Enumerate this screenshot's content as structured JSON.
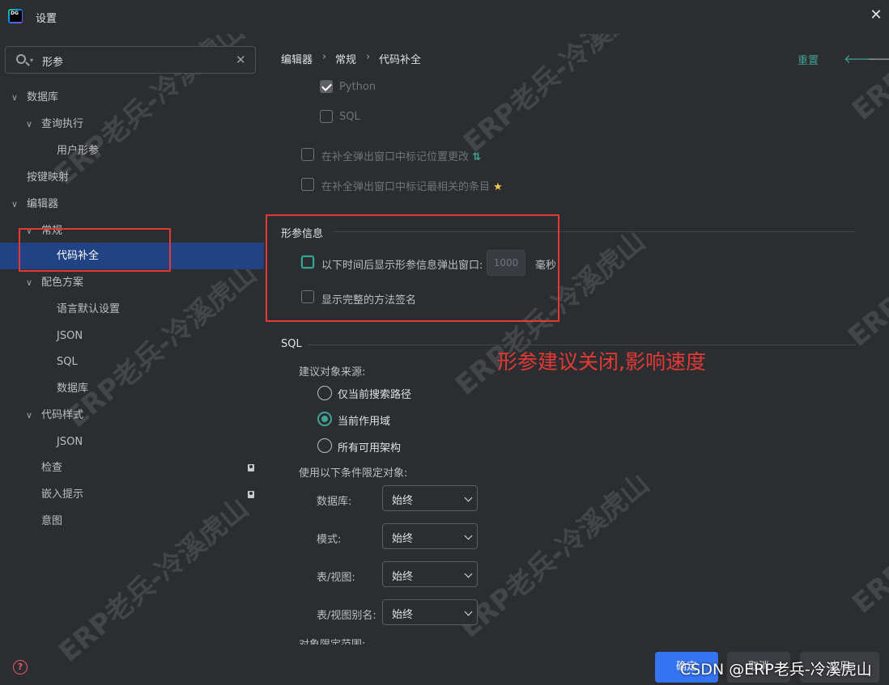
{
  "window": {
    "title": "设置"
  },
  "search": {
    "value": "形参"
  },
  "tree": [
    {
      "label": "数据库",
      "chev": "∨"
    },
    {
      "label": "查询执行",
      "chev": "∨"
    },
    {
      "label": "用户形参",
      "chev": ""
    },
    {
      "label": "按键映射",
      "chev": ""
    },
    {
      "label": "编辑器",
      "chev": "∨"
    },
    {
      "label": "常规",
      "chev": "∨"
    },
    {
      "label": "代码补全",
      "chev": ""
    },
    {
      "label": "配色方案",
      "chev": "∨"
    },
    {
      "label": "语言默认设置",
      "chev": ""
    },
    {
      "label": "JSON",
      "chev": ""
    },
    {
      "label": "SQL",
      "chev": ""
    },
    {
      "label": "数据库",
      "chev": ""
    },
    {
      "label": "代码样式",
      "chev": "∨"
    },
    {
      "label": "JSON",
      "chev": ""
    },
    {
      "label": "检查",
      "chev": ""
    },
    {
      "label": "嵌入提示",
      "chev": ""
    },
    {
      "label": "意图",
      "chev": ""
    }
  ],
  "breadcrumb": [
    "编辑器",
    "常规",
    "代码补全"
  ],
  "header": {
    "reset": "重置",
    "sep": "›",
    "back": "🡐",
    "fwd": "🡒"
  },
  "top_options": [
    {
      "label": "Python",
      "checked": true
    },
    {
      "label": "SQL",
      "checked": false
    }
  ],
  "popup_options": [
    {
      "label": "在补全弹出窗口中标记位置更改",
      "suffix": "⇅"
    },
    {
      "label": "在补全弹出窗口中标记最相关的条目",
      "suffix": "★"
    }
  ],
  "param_info": {
    "title": "形参信息",
    "delay_label": "以下时间后显示形参信息弹出窗口:",
    "delay_value": "1000",
    "delay_unit": "毫秒",
    "full_signature": "显示完整的方法签名"
  },
  "sql": {
    "title": "SQL",
    "source_label": "建议对象来源:",
    "sources": [
      {
        "label": "仅当前搜索路径",
        "checked": false
      },
      {
        "label": "当前作用域",
        "checked": true
      },
      {
        "label": "所有可用架构",
        "checked": false
      }
    ],
    "limit_label": "使用以下条件限定对象:",
    "fields": [
      {
        "label": "数据库:",
        "value": "始终"
      },
      {
        "label": "模式:",
        "value": "始终"
      },
      {
        "label": "表/视图:",
        "value": "始终"
      },
      {
        "label": "表/视图别名:",
        "value": "始终"
      }
    ],
    "cut_label": "对象限定范围:"
  },
  "annotation": "形参建议关闭,影响速度",
  "buttons": {
    "ok": "确定",
    "cancel": "取消",
    "apply": "应用"
  },
  "footer_watermark": "CSDN @ERP老兵-冷溪虎山",
  "watermark": "ERP老兵-冷溪虎山",
  "colors": {
    "accent": "#3fa394",
    "selection": "#214283",
    "annotation": "#e53935",
    "primary_button": "#3574f0"
  }
}
